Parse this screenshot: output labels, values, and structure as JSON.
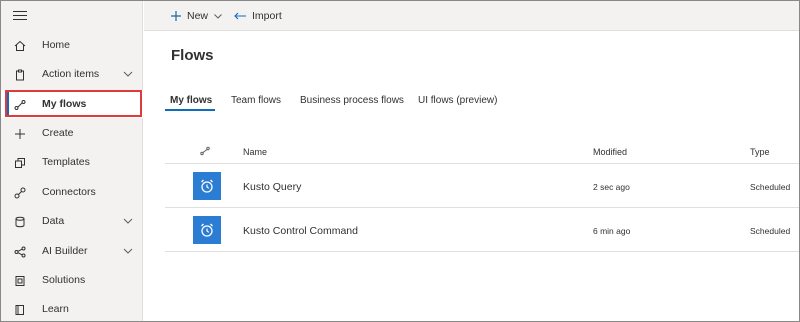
{
  "sidebar": {
    "items": [
      {
        "label": "Home",
        "icon": "home-icon",
        "has_chevron": false
      },
      {
        "label": "Action items",
        "icon": "clipboard-icon",
        "has_chevron": true
      },
      {
        "label": "My flows",
        "icon": "flow-icon",
        "has_chevron": false,
        "selected": true
      },
      {
        "label": "Create",
        "icon": "plus-icon",
        "has_chevron": false
      },
      {
        "label": "Templates",
        "icon": "templates-icon",
        "has_chevron": false
      },
      {
        "label": "Connectors",
        "icon": "connector-icon",
        "has_chevron": false
      },
      {
        "label": "Data",
        "icon": "database-icon",
        "has_chevron": true
      },
      {
        "label": "AI Builder",
        "icon": "ai-builder-icon",
        "has_chevron": true
      },
      {
        "label": "Solutions",
        "icon": "solutions-icon",
        "has_chevron": false
      },
      {
        "label": "Learn",
        "icon": "book-icon",
        "has_chevron": false
      }
    ]
  },
  "toolbar": {
    "new_label": "New",
    "import_label": "Import"
  },
  "main": {
    "title": "Flows",
    "tabs": [
      {
        "label": "My flows",
        "active": true
      },
      {
        "label": "Team flows",
        "active": false
      },
      {
        "label": "Business process flows",
        "active": false
      },
      {
        "label": "UI flows (preview)",
        "active": false
      }
    ],
    "table": {
      "columns": {
        "name": "Name",
        "modified": "Modified",
        "type": "Type"
      },
      "rows": [
        {
          "name": "Kusto Query",
          "modified": "2 sec ago",
          "type": "Scheduled"
        },
        {
          "name": "Kusto Control Command",
          "modified": "6 min ago",
          "type": "Scheduled"
        }
      ]
    }
  },
  "colors": {
    "accent": "#0f6cbd",
    "flow_tile": "#2b7cd3",
    "highlight": "#e03a3a",
    "sidebar_bg": "#f3f2f1"
  }
}
